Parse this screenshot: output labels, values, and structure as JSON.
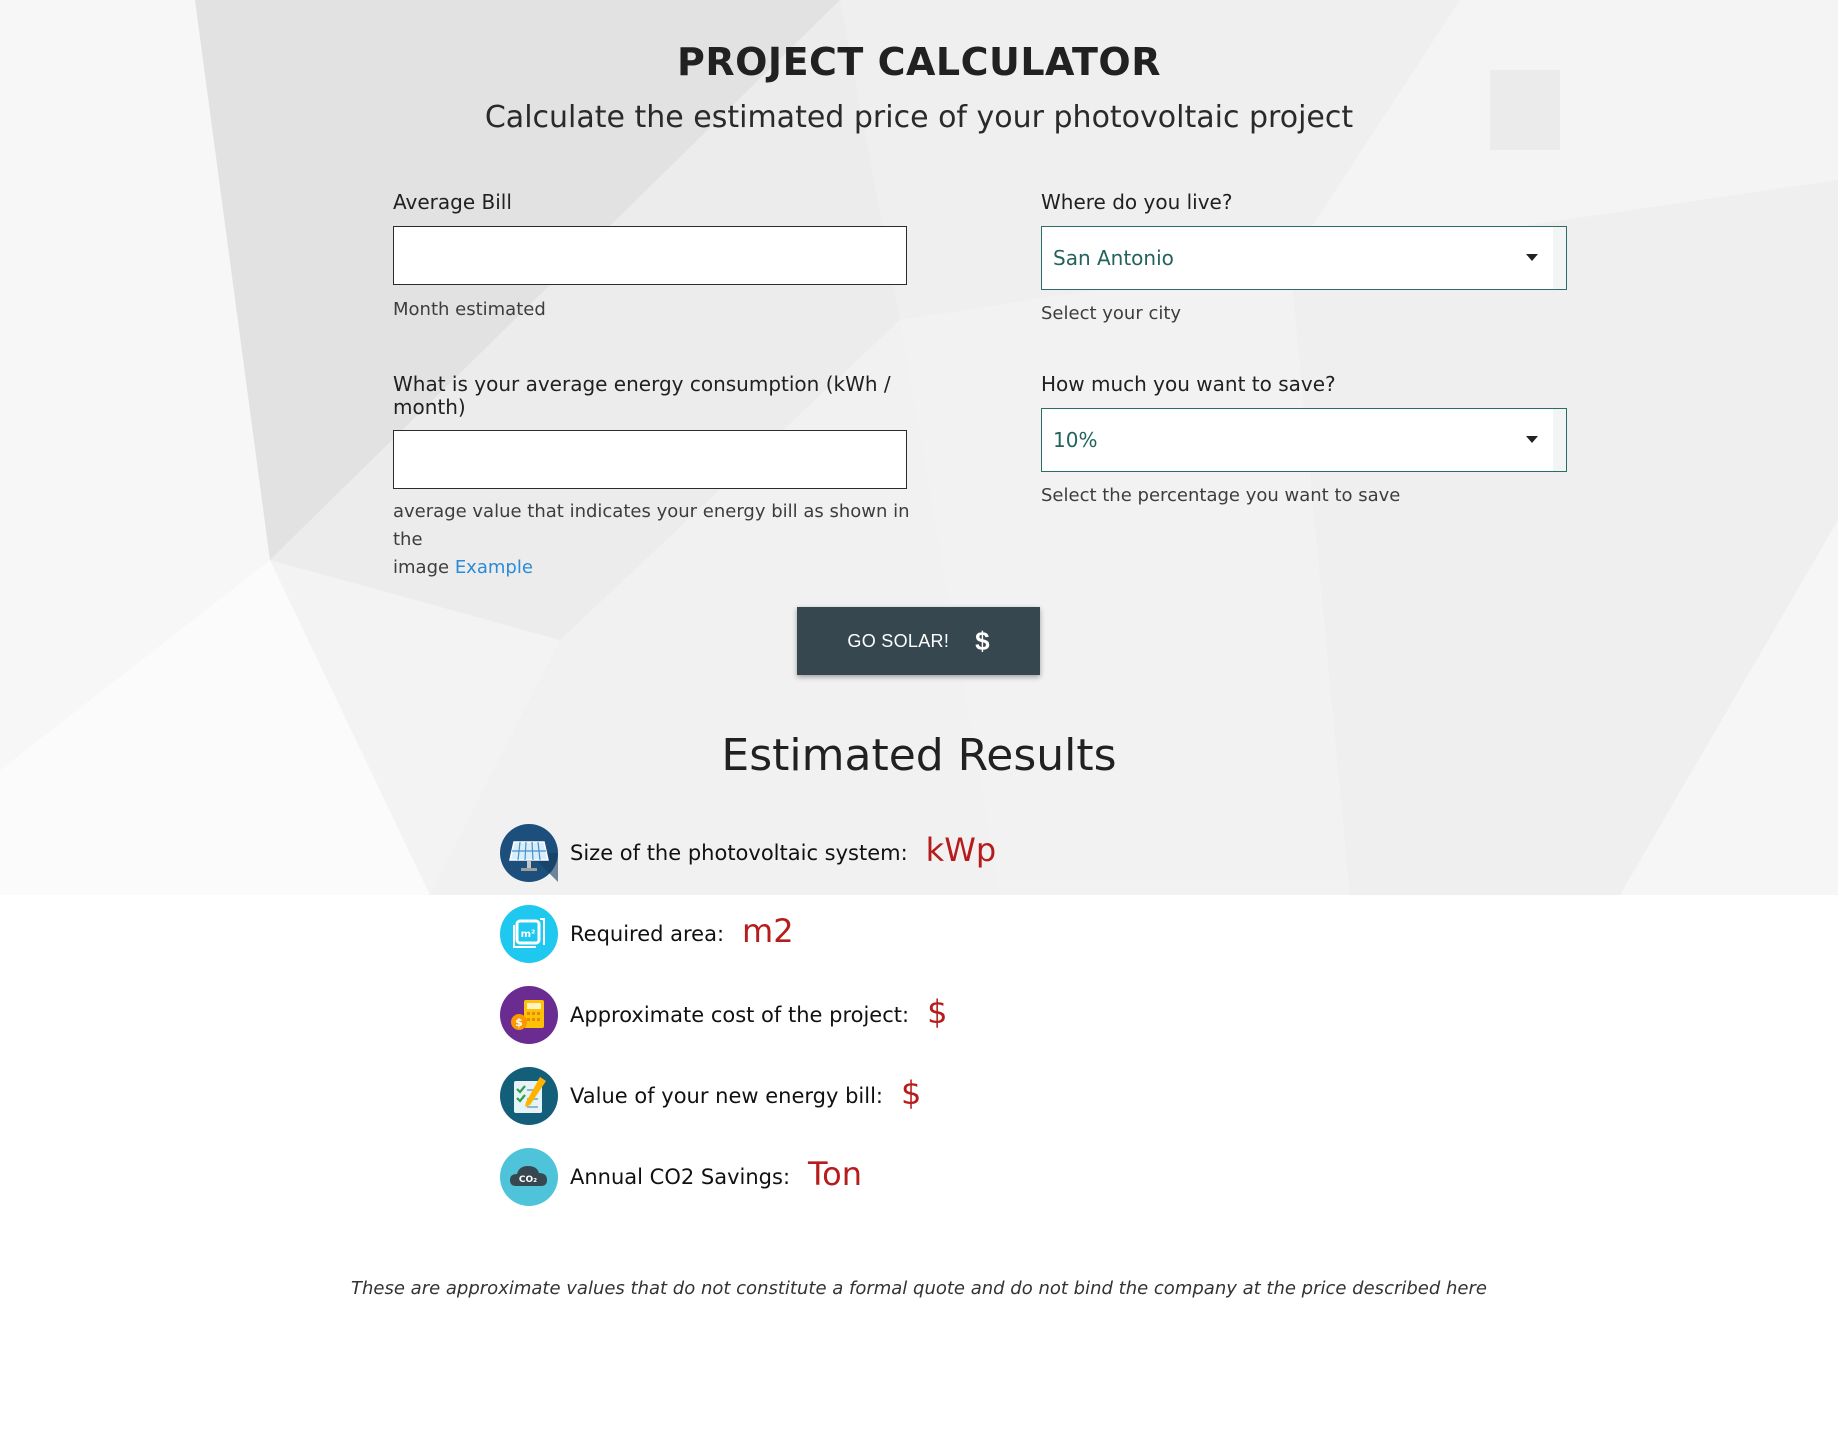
{
  "header": {
    "title": "PROJECT CALCULATOR",
    "subtitle": "Calculate the estimated price of your photovoltaic project"
  },
  "form": {
    "average_bill": {
      "label": "Average Bill",
      "value": "",
      "helper": "Month estimated"
    },
    "city": {
      "label": "Where do you live?",
      "selected": "San Antonio",
      "helper": "Select your city"
    },
    "consumption": {
      "label_line1": "What is your average energy consumption (kWh /",
      "label_line2": "month)",
      "value": "",
      "helper_line1": "average value that indicates your energy bill as shown in the",
      "helper_line2_prefix": "image",
      "helper_link": "Example"
    },
    "savings": {
      "label": "How much you want to save?",
      "selected": "10%",
      "helper": "Select the percentage you want to save"
    },
    "submit_label": "GO SOLAR!",
    "submit_icon": "$"
  },
  "results": {
    "title": "Estimated Results",
    "items": [
      {
        "label": "Size of the photovoltaic system:",
        "unit": "kWp",
        "icon": "solar-panel-icon"
      },
      {
        "label": "Required area:",
        "unit": "m2",
        "icon": "area-m2-icon"
      },
      {
        "label": "Approximate cost of the project:",
        "unit": "$",
        "icon": "calculator-coin-icon"
      },
      {
        "label": "Value of your new energy bill:",
        "unit": "$",
        "icon": "bill-checklist-icon"
      },
      {
        "label": "Annual CO2 Savings:",
        "unit": "Ton",
        "icon": "co2-cloud-icon"
      }
    ]
  },
  "disclaimer": "These are approximate values that do not constitute a formal quote and do not bind the company at the price described here",
  "colors": {
    "button_bg": "#37474f",
    "select_border": "#2c6b66",
    "select_text": "#23625d",
    "unit_red": "#b71c1c",
    "link_blue": "#2b8bd6"
  }
}
